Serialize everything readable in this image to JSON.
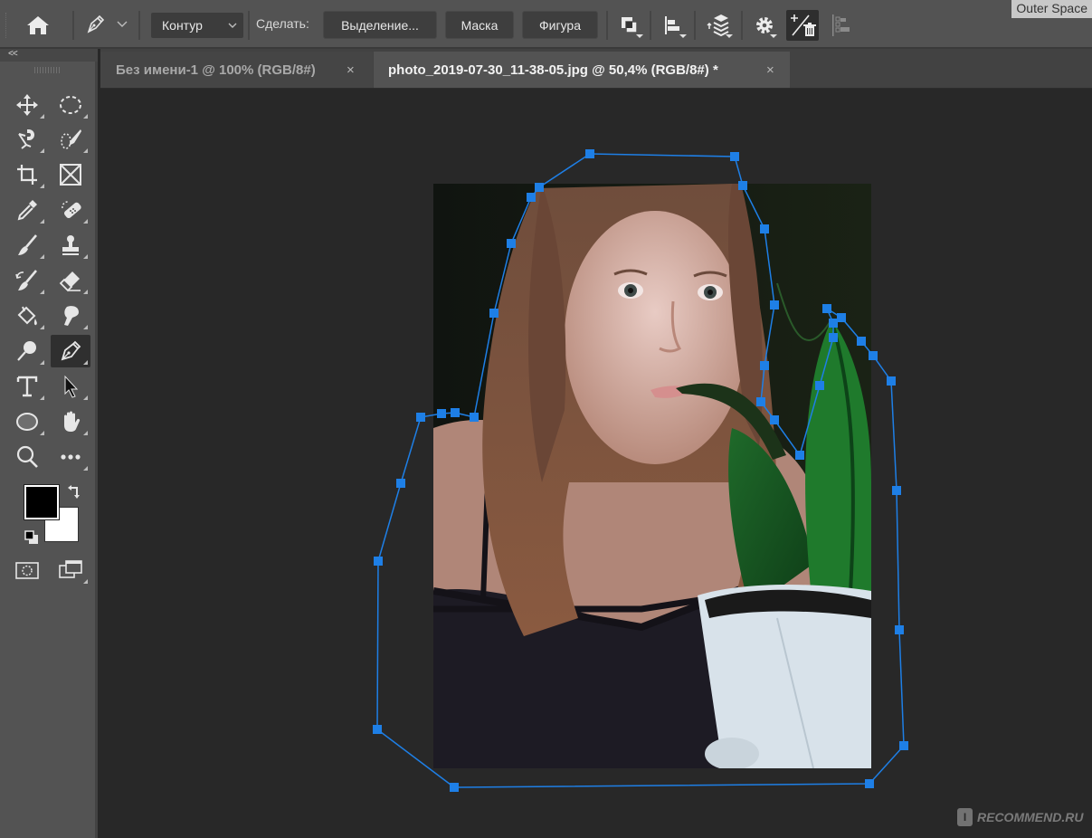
{
  "app": {
    "workspace": "Outer Space"
  },
  "options_bar": {
    "home_icon": "home-icon",
    "tool_preset_icon": "pen-icon",
    "mode_select": {
      "value": "Контур"
    },
    "make_label": "Сделать:",
    "buttons": [
      {
        "label": "Выделение..."
      },
      {
        "label": "Маска"
      },
      {
        "label": "Фигура"
      }
    ],
    "icons": [
      "path-operations-icon",
      "path-alignment-icon",
      "path-arrangement-icon",
      "settings-gear-icon",
      "auto-add-delete-icon",
      "align-edges-icon"
    ]
  },
  "tabs": [
    {
      "label": "Без имени-1 @ 100% (RGB/8#)",
      "close": "×",
      "active": false
    },
    {
      "label": "photo_2019-07-30_11-38-05.jpg @ 50,4% (RGB/8#) *",
      "close": "×",
      "active": true
    }
  ],
  "toolbar": {
    "collapse_label": "<<",
    "tools": [
      {
        "name": "move-tool",
        "icon": "move-icon"
      },
      {
        "name": "elliptical-marquee-tool",
        "icon": "ellipse-marquee-icon"
      },
      {
        "name": "magnetic-lasso-tool",
        "icon": "magnetic-lasso-icon"
      },
      {
        "name": "quick-selection-tool",
        "icon": "quick-selection-icon"
      },
      {
        "name": "crop-tool",
        "icon": "crop-icon"
      },
      {
        "name": "frame-tool",
        "icon": "frame-icon"
      },
      {
        "name": "eyedropper-tool",
        "icon": "eyedropper-icon"
      },
      {
        "name": "spot-healing-tool",
        "icon": "bandage-icon"
      },
      {
        "name": "brush-tool",
        "icon": "brush-icon"
      },
      {
        "name": "clone-stamp-tool",
        "icon": "stamp-icon"
      },
      {
        "name": "history-brush-tool",
        "icon": "history-brush-icon"
      },
      {
        "name": "eraser-tool",
        "icon": "eraser-icon"
      },
      {
        "name": "paint-bucket-tool",
        "icon": "paint-bucket-icon"
      },
      {
        "name": "smudge-tool",
        "icon": "smudge-icon"
      },
      {
        "name": "dodge-tool",
        "icon": "dodge-icon"
      },
      {
        "name": "pen-tool",
        "icon": "pen-icon",
        "active": true
      },
      {
        "name": "type-tool",
        "icon": "type-icon"
      },
      {
        "name": "path-selection-tool",
        "icon": "arrow-icon"
      },
      {
        "name": "ellipse-tool",
        "icon": "ellipse-shape-icon"
      },
      {
        "name": "hand-tool",
        "icon": "hand-icon"
      },
      {
        "name": "zoom-tool",
        "icon": "magnifier-icon"
      },
      {
        "name": "edit-toolbar",
        "icon": "more-icon"
      }
    ],
    "foreground_color": "#000000",
    "background_color": "#ffffff"
  },
  "canvas": {
    "document": "photo_2019-07-30_11-38-05.jpg",
    "zoom": "50,4%",
    "path_color": "#1e7fe6",
    "path_anchor_count": 32
  },
  "watermark": {
    "logo": "I",
    "text": "RECOMMEND.RU"
  }
}
